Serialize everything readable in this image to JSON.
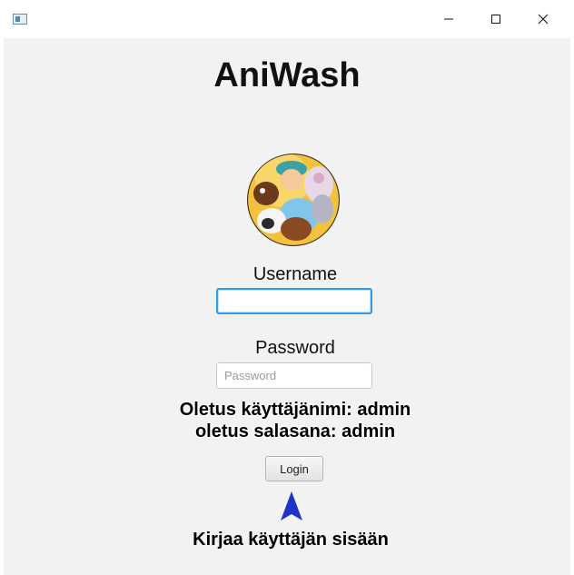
{
  "window": {
    "title": "",
    "controls": {
      "minimize": "minimize-icon",
      "maximize": "maximize-icon",
      "close": "close-icon"
    }
  },
  "app": {
    "title": "AniWash",
    "logo": "aniwash-logo-image"
  },
  "form": {
    "username_label": "Username",
    "username_value": "",
    "password_label": "Password",
    "password_value": "",
    "password_placeholder": "Password",
    "login_label": "Login"
  },
  "annotations": {
    "default_username": "Oletus käyttäjänimi: admin",
    "default_password": "oletus salasana: admin",
    "login_caption": "Kirjaa käyttäjän sisään",
    "arrow_color": "#1f33c7"
  },
  "colors": {
    "focus": "#2f9ee6",
    "background": "#f2f2f2"
  }
}
